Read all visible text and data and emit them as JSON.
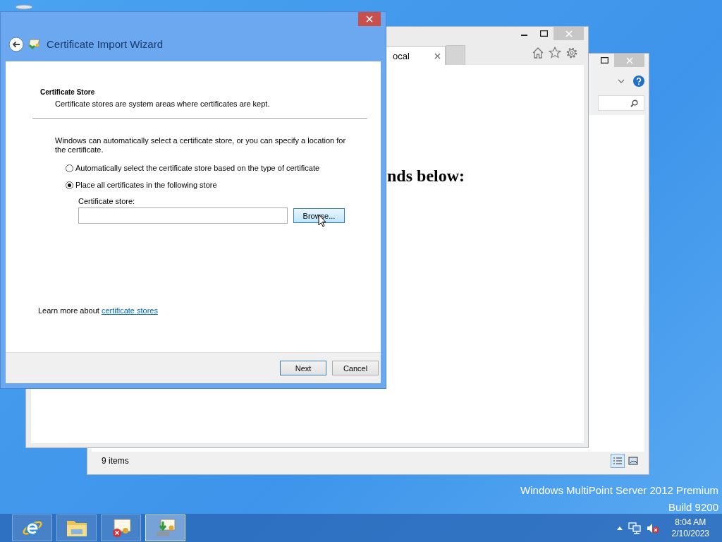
{
  "explorer_window": {
    "status_text": "9 items"
  },
  "browser_window": {
    "tab": {
      "label": "ocal",
      "selected": true
    },
    "page_heading": "nds below:"
  },
  "wizard": {
    "title": "Certificate Import Wizard",
    "section_title": "Certificate Store",
    "section_description": "Certificate stores are system areas where certificates are kept.",
    "intro": "Windows can automatically select a certificate store, or you can specify a location for the certificate.",
    "options": [
      {
        "label": "Automatically select the certificate store based on the type of certificate",
        "selected": false
      },
      {
        "label": "Place all certificates in the following store",
        "selected": true
      }
    ],
    "store_label": "Certificate store:",
    "browse_button": "Browse...",
    "learn_more": {
      "text": "Learn more about",
      "link": "certificate stores"
    },
    "buttons": [
      {
        "label": "Next",
        "kind": "default"
      },
      {
        "label": "Cancel",
        "kind": "normal"
      }
    ]
  },
  "desktop_text": [
    "Windows MultiPoint Server 2012 Premium",
    "Build 9200"
  ],
  "taskbar": {
    "apps": [
      {
        "kind": "browser",
        "selected": false
      },
      {
        "kind": "folder",
        "selected": false
      },
      {
        "kind": "certificate-error",
        "selected": false
      },
      {
        "kind": "certificate-import",
        "selected": true
      }
    ],
    "time": "8:04 AM",
    "date": "2/10/2023"
  }
}
